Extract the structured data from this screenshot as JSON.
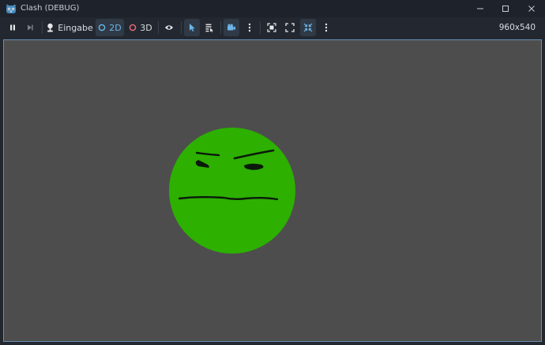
{
  "window": {
    "title": "Clash (DEBUG)",
    "controls": {
      "minimize_icon": "minimize-icon",
      "maximize_icon": "maximize-icon",
      "close_icon": "close-icon"
    }
  },
  "toolbar": {
    "input_label": "Eingabe",
    "mode_2d_label": "2D",
    "mode_3d_label": "3D",
    "resolution": "960x540"
  },
  "colors": {
    "face_fill": "#2db000",
    "viewport_bg": "#4d4d4d",
    "accent_2d": "#6cb6e8",
    "accent_3d": "#f06b7a",
    "active_icon": "#6cb6e8"
  }
}
